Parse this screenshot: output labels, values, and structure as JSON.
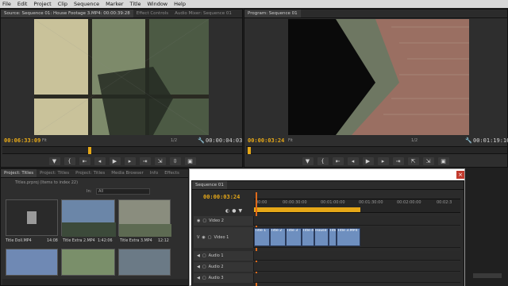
{
  "menu": [
    "File",
    "Edit",
    "Project",
    "Clip",
    "Sequence",
    "Marker",
    "Title",
    "Window",
    "Help"
  ],
  "source": {
    "tabs": [
      "Source: Sequence 01: House Footage 3.MP4: 00:00:39:28",
      "Effect Controls",
      "Audio Mixer: Sequence 01"
    ],
    "timecode_in": "00:06:33:09",
    "timecode_dur": "00:00:04:03",
    "fit": "Fit",
    "res": "1/2"
  },
  "program": {
    "tabs": [
      "Program: Sequence 01"
    ],
    "timecode_in": "00:00:03:24",
    "timecode_dur": "00:01:19:16",
    "fit": "Fit",
    "res": "1/2"
  },
  "project": {
    "tabs": [
      "Project: Titles",
      "Project: Titles",
      "Project: Titles",
      "Media Browser",
      "Info",
      "Effects"
    ],
    "file": "Titles.prproj",
    "items_info": "Items to index 22",
    "in_label": "In:",
    "in_value": "All",
    "items": [
      {
        "name": "Title Doll.MP4",
        "dur": "14:08"
      },
      {
        "name": "Title Extra 2.MP4",
        "dur": "1:42:06"
      },
      {
        "name": "Title Extra 3.MP4",
        "dur": "12:12"
      }
    ]
  },
  "sequence": {
    "title": "Sequence 01",
    "timecode": "00:00:03:24",
    "ruler": [
      "00:00",
      "00:00:30:00",
      "00:01:00:00",
      "00:01:30:00",
      "00:02:00:00",
      "00:02:3"
    ],
    "tracks": [
      {
        "name": "Video 2",
        "type": "video"
      },
      {
        "name": "Video 1",
        "type": "video"
      },
      {
        "name": "Audio 1",
        "type": "audio"
      },
      {
        "name": "Audio 2",
        "type": "audio"
      },
      {
        "name": "Audio 3",
        "type": "audio"
      }
    ],
    "clips": [
      "Title 1",
      "Title 2",
      "Title 3",
      "Title 4",
      "House",
      "Title 5",
      "Title 3.MP4"
    ],
    "close_icon": "close-icon"
  },
  "colors": {
    "timecode": "#e6a818",
    "clip": "#6e8fbf",
    "close": "#c23b2e"
  }
}
